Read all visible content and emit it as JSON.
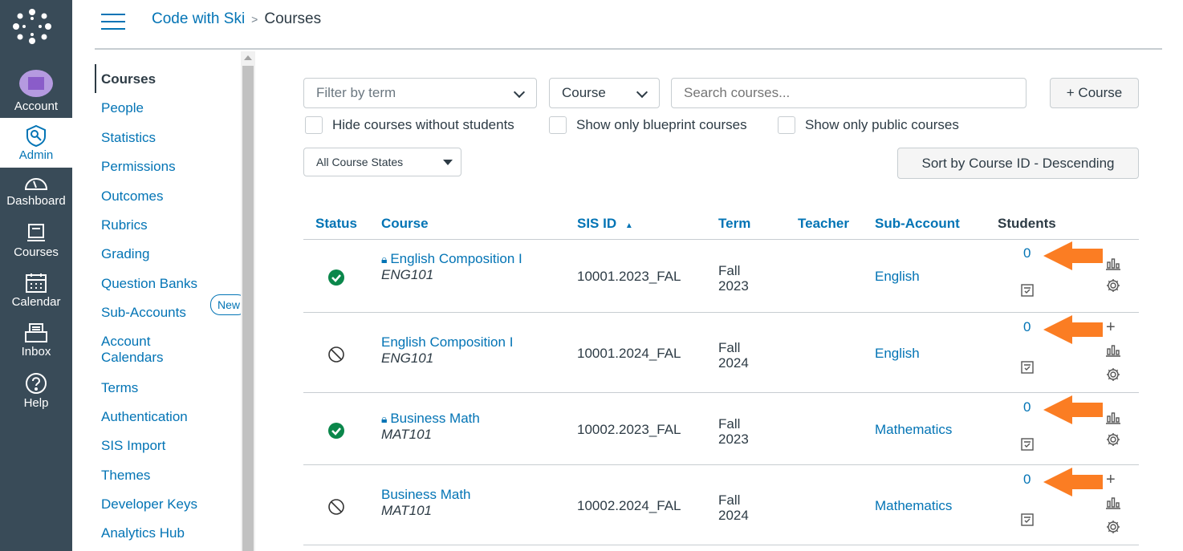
{
  "global_nav": [
    {
      "label": "Account",
      "icon": "avatar"
    },
    {
      "label": "Admin",
      "icon": "admin-shield-icon",
      "active": true
    },
    {
      "label": "Dashboard",
      "icon": "dashboard-icon"
    },
    {
      "label": "Courses",
      "icon": "courses-icon"
    },
    {
      "label": "Calendar",
      "icon": "calendar-icon"
    },
    {
      "label": "Inbox",
      "icon": "inbox-icon"
    },
    {
      "label": "Help",
      "icon": "help-icon"
    }
  ],
  "breadcrumb": {
    "account": "Code with Ski",
    "current": "Courses",
    "separator": ">"
  },
  "sub_nav": [
    {
      "label": "Courses"
    },
    {
      "label": "People"
    },
    {
      "label": "Statistics"
    },
    {
      "label": "Permissions"
    },
    {
      "label": "Outcomes"
    },
    {
      "label": "Rubrics"
    },
    {
      "label": "Grading"
    },
    {
      "label": "Question Banks"
    },
    {
      "label": "Sub-Accounts"
    },
    {
      "label": "Account Calendars",
      "badge": "New"
    },
    {
      "label": "Terms"
    },
    {
      "label": "Authentication"
    },
    {
      "label": "SIS Import"
    },
    {
      "label": "Themes"
    },
    {
      "label": "Developer Keys"
    },
    {
      "label": "Analytics Hub"
    }
  ],
  "filters": {
    "term_placeholder": "Filter by term",
    "type_value": "Course",
    "search_placeholder": "Search courses...",
    "add_course": "+ Course",
    "hide_without_students": "Hide courses without students",
    "blueprint_only": "Show only blueprint courses",
    "public_only": "Show only public courses",
    "states_value": "All Course States",
    "sort_label": "Sort by Course ID - Descending"
  },
  "table": {
    "headers": [
      "Status",
      "Course",
      "SIS ID",
      "Term",
      "Teacher",
      "Sub-Account",
      "Students"
    ],
    "sort_indicator": "▲",
    "rows": [
      {
        "status": "published",
        "locked": true,
        "course": "English Composition I",
        "code": "ENG101",
        "sis": "10001.2023_FAL",
        "term1": "Fall",
        "term2": "2023",
        "teacher": "",
        "subaccount": "English",
        "students": "0",
        "add": false
      },
      {
        "status": "unpublished",
        "locked": false,
        "course": "English Composition I",
        "code": "ENG101",
        "sis": "10001.2024_FAL",
        "term1": "Fall",
        "term2": "2024",
        "teacher": "",
        "subaccount": "English",
        "students": "0",
        "add": true
      },
      {
        "status": "published",
        "locked": true,
        "course": "Business Math",
        "code": "MAT101",
        "sis": "10002.2023_FAL",
        "term1": "Fall",
        "term2": "2023",
        "teacher": "",
        "subaccount": "Mathematics",
        "students": "0",
        "add": false
      },
      {
        "status": "unpublished",
        "locked": false,
        "course": "Business Math",
        "code": "MAT101",
        "sis": "10002.2024_FAL",
        "term1": "Fall",
        "term2": "2024",
        "teacher": "",
        "subaccount": "Mathematics",
        "students": "0",
        "add": true
      }
    ]
  },
  "colors": {
    "nav_bg": "#394b58",
    "link": "#0374b5",
    "published": "#0b874b",
    "annotation_arrow": "#fb7d23"
  }
}
